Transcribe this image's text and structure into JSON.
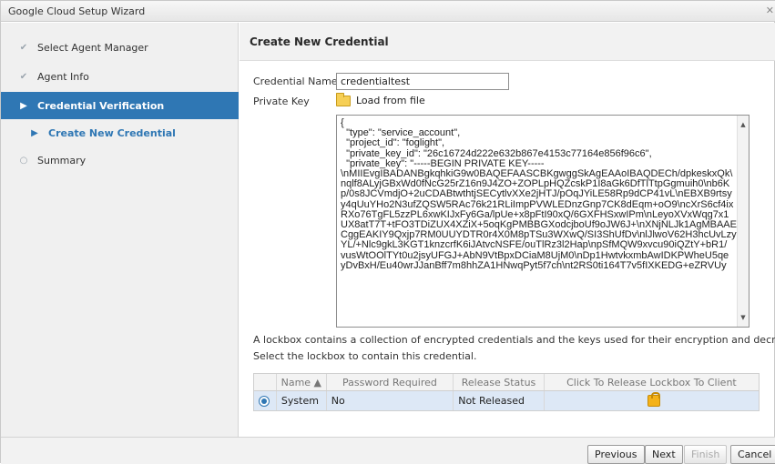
{
  "window": {
    "title": "Google Cloud Setup Wizard"
  },
  "sidebar": {
    "items": [
      {
        "label": "Select Agent Manager",
        "state": "done"
      },
      {
        "label": "Agent Info",
        "state": "done"
      },
      {
        "label": "Credential Verification",
        "state": "active"
      },
      {
        "label": "Create New Credential",
        "state": "sub"
      },
      {
        "label": "Summary",
        "state": "pending"
      }
    ]
  },
  "main": {
    "title": "Create New Credential",
    "credential_name_label": "Credential Name",
    "credential_name_value": "credentialtest",
    "private_key_label": "Private Key",
    "load_from_file": "Load from file",
    "private_key_text": "{\n  \"type\": \"service_account\",\n  \"project_id\": \"foglight\",\n  \"private_key_id\": \"26c16724d222e632b867e4153c77164e856f96c6\",\n  \"private_key\": \"-----BEGIN PRIVATE KEY-----\n\\nMIIEvgIBADANBgkqhkiG9w0BAQEFAASCBKgwggSkAgEAAoIBAQDECh/dpkeskxQk\\\nnqlf8ALyjGBxWd0fNcG25rZ16n9J4ZO+ZOPLpHQZcskP1I8aGk6DfTlTtpGgmuih0\\nb6K\np/0s8JCVmdjO+2uCDABtwthtjSECytlvXXe2jHTJ/pOqJYiLE58Rp9dCP41vL\\nEBXB9rtsy\ny4qUuYHo2N3ufZQSW5RAc76k21RLiImpPVWLEDnzGnp7CK8dEqm+oO9\\ncXrS6cf4ix\nRXo76TgFL5zzPL6xwKIJxFy6Ga/lpUe+x8pFtI90xQ/6GXFHSxwIPm\\nLeyoXVxWqg7x1\nUX8atT7T+tFO3TDiZUX4XZiX+5oqKgPMBBGXodcjboUf9oJW6J+\\nXNjNLJk1AgMBAAE\nCggEAKIY9Qxjp7RM0UUYDTR0r4X0M8pTSu3WXwQ/SI3ShUfDv\\nlJlwoV62H3hcUvLzy\nYL/+Nlc9gkL3KGT1knzcrfK6iJAtvcNSFE/ouTlRz3l2Hap\\npSfMQW9xvcu90iQZtY+bR1/\nvusWtOOlTYt0u2jsyUFGJ+AbN9VtBpxDCiaM8UjM0\\nDp1HwtvkxmbAwIDKPWheU5qe\nyDvBxH/Eu40wrJJanBff7m8hhZA1HNwqPyt5f7ch\\nt2RS0ti164T7v5fIXKEDG+eZRVUy",
    "info_line1": "A lockbox contains a collection of encrypted credentials and the keys used for their encryption and decryption.",
    "info_line2": "Select the lockbox to contain this credential.",
    "grid": {
      "columns": [
        "Name ▲",
        "Password Required",
        "Release Status",
        "Click To Release Lockbox To Client"
      ],
      "rows": [
        {
          "name": "System",
          "password_required": "No",
          "release_status": "Not Released",
          "selected": true
        }
      ]
    }
  },
  "footer": {
    "previous": "Previous",
    "next": "Next",
    "finish": "Finish",
    "cancel": "Cancel"
  },
  "colors": {
    "accent": "#2f77b4",
    "selected_row": "#dde8f6"
  }
}
